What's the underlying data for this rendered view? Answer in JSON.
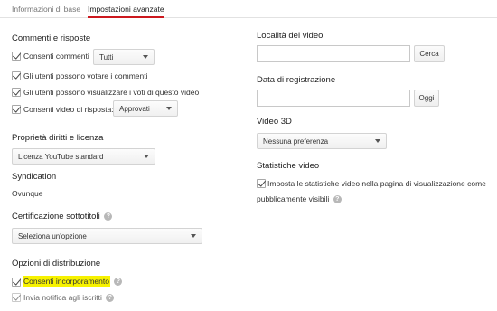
{
  "tabs": [
    {
      "label": "Informazioni di base"
    },
    {
      "label": "Impostazioni avanzate"
    }
  ],
  "left": {
    "comments": {
      "title": "Commenti e risposte",
      "allow_comments_label": "Consenti commenti",
      "allow_comments_select": "Tutti",
      "users_vote_label": "Gli utenti possono votare i commenti",
      "users_view_votes_label": "Gli utenti possono visualizzare i voti di questo video",
      "video_responses_label": "Consenti video di risposta:",
      "video_responses_select": "Approvati"
    },
    "rights": {
      "title": "Proprietà diritti e licenza",
      "license_select": "Licenza YouTube standard"
    },
    "syndication": {
      "title": "Syndication",
      "value": "Ovunque"
    },
    "captions": {
      "title": "Certificazione sottotitoli",
      "help_icon": "?",
      "select_placeholder": "Seleziona un'opzione"
    },
    "distribution": {
      "title": "Opzioni di distribuzione",
      "embed_label": "Consenti incorporamento",
      "notify_label": "Invia notifica agli iscritti",
      "help_icon": "?"
    }
  },
  "right": {
    "location": {
      "title": "Località del video",
      "input_value": "",
      "search_button": "Cerca"
    },
    "recording_date": {
      "title": "Data di registrazione",
      "input_value": "",
      "today_button": "Oggi"
    },
    "video3d": {
      "title": "Video 3D",
      "select_value": "Nessuna preferenza"
    },
    "stats": {
      "title": "Statistiche video",
      "public_stats_label_line1": "Imposta le statistiche video nella pagina di visualizzazione come",
      "public_stats_label_line2": "pubblicamente visibili",
      "help_icon": "?"
    }
  },
  "colors": {
    "highlight": "#f7f200",
    "active_tab_underline": "#cc181e"
  }
}
